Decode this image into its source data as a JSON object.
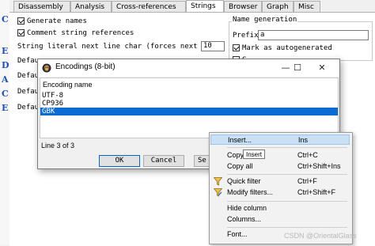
{
  "tabs": [
    "Disassembly",
    "Analysis",
    "Cross-references",
    "Strings",
    "Browser",
    "Graph",
    "Misc"
  ],
  "active_tab": "Strings",
  "left_strip_glyphs": [
    "C",
    "E",
    "D",
    "A",
    "C",
    "E"
  ],
  "options": {
    "generate_names": "Generate names",
    "comment_string_refs": "Comment string references",
    "literal_next_line_label": "String literal next line char (forces next line)",
    "literal_next_line_value": "10",
    "default_labels": [
      "Defau",
      "Defau",
      "Defau",
      "Defau"
    ]
  },
  "name_generation": {
    "group_label": "Name generation",
    "prefix_label": "Prefix",
    "prefix_value": "a",
    "mark_autogenerated": "Mark as autogenerated",
    "generate_serial": "G"
  },
  "dialog": {
    "title": "Encodings (8-bit)",
    "column_header": "Encoding name",
    "items": [
      "UTF-8",
      "CP936",
      "GBK"
    ],
    "selected_index": 2,
    "status": "Line 3 of 3",
    "ok_label": "OK",
    "cancel_label": "Cancel",
    "search_label": "Se",
    "minimize": "—",
    "maximize": "☐",
    "close": "✕"
  },
  "context_menu": {
    "items": [
      {
        "label": "Insert...",
        "shortcut": "Ins",
        "highlighted": true
      },
      {
        "label": "Copy",
        "shortcut": "Ctrl+C"
      },
      {
        "label": "Copy all",
        "shortcut": "Ctrl+Shift+Ins"
      },
      {
        "label": "Quick filter",
        "shortcut": "Ctrl+F",
        "icon": "funnel-icon"
      },
      {
        "label": "Modify filters...",
        "shortcut": "Ctrl+Shift+F",
        "icon": "funnel-icon"
      },
      {
        "label": "Hide column",
        "shortcut": ""
      },
      {
        "label": "Columns...",
        "shortcut": ""
      },
      {
        "label": "Font...",
        "shortcut": ""
      }
    ],
    "tooltip": "Insert"
  },
  "watermark": "CSDN @OrientalGlass"
}
